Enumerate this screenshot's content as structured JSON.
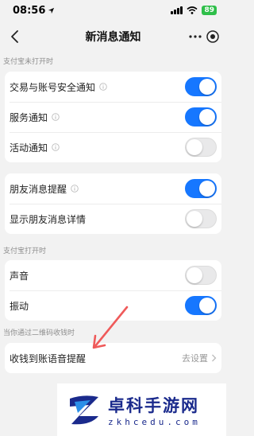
{
  "status_bar": {
    "time": "08:56",
    "battery": "89"
  },
  "nav": {
    "title": "新消息通知"
  },
  "sections": [
    {
      "header": "支付宝未打开时",
      "rows": [
        {
          "label": "交易与账号安全通知",
          "info": true,
          "toggle": "on"
        },
        {
          "label": "服务通知",
          "info": true,
          "toggle": "on"
        },
        {
          "label": "活动通知",
          "info": true,
          "toggle": "off"
        }
      ]
    },
    {
      "header": "",
      "rows": [
        {
          "label": "朋友消息提醒",
          "info": true,
          "toggle": "on"
        },
        {
          "label": "显示朋友消息详情",
          "info": false,
          "toggle": "off"
        }
      ]
    },
    {
      "header": "支付宝打开时",
      "rows": [
        {
          "label": "声音",
          "info": false,
          "toggle": "off"
        },
        {
          "label": "振动",
          "info": false,
          "toggle": "on"
        }
      ]
    },
    {
      "header": "当你通过二维码收钱时",
      "rows": [
        {
          "label": "收钱到账语音提醒",
          "value": "去设置"
        }
      ]
    }
  ],
  "watermark": {
    "title": "卓科手游网",
    "url": "zkhcedu.com"
  },
  "colors": {
    "accent": "#1677ff",
    "arrow": "#ef5a5a",
    "watermark": "#1a2a8c"
  }
}
